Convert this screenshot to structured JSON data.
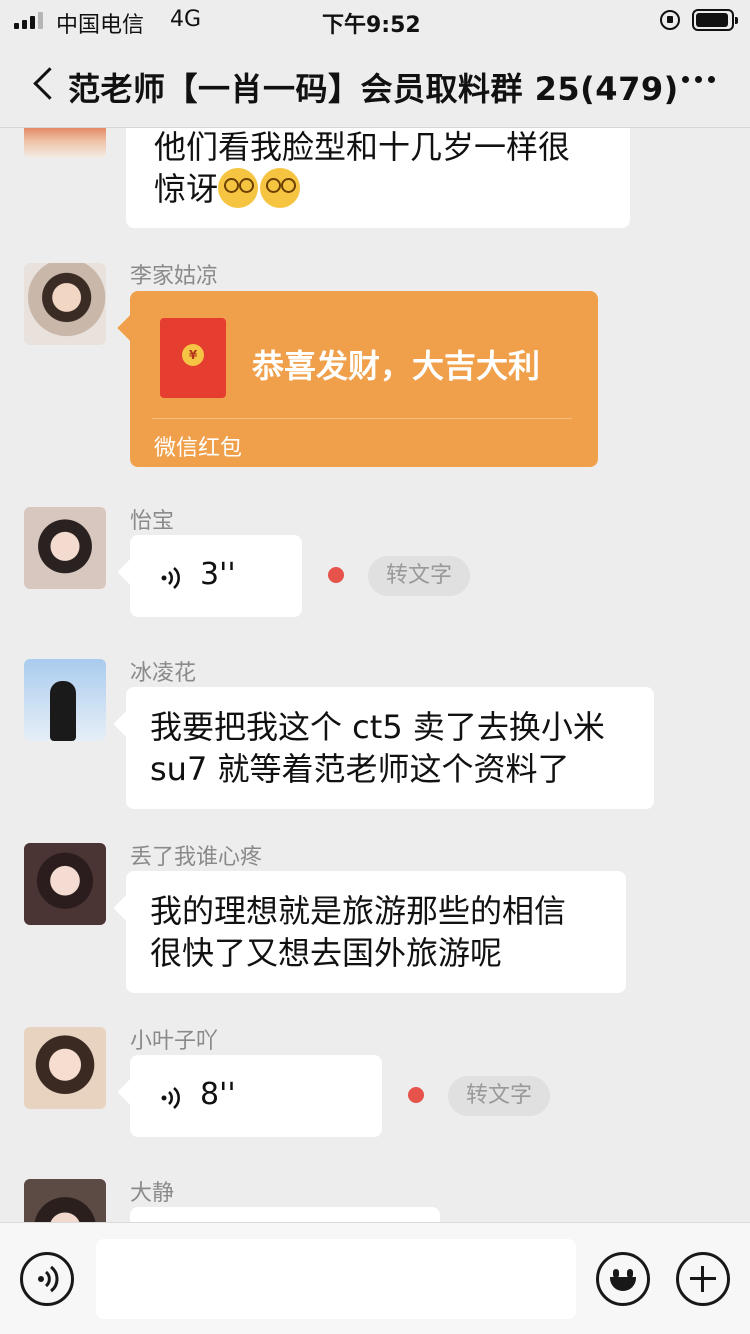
{
  "status": {
    "carrier": "中国电信",
    "network": "4G",
    "time": "下午9:52",
    "battery_level": 0.95
  },
  "header": {
    "title": "范老师【一肖一码】会员取料群 25(479)",
    "back_icon": "chevron-left-icon",
    "more_icon": "ellipsis-icon"
  },
  "messages": [
    {
      "type": "text",
      "sender": "",
      "text": "他们看我脸型和十几岁一样很\n惊讶",
      "emoji_count": 2
    },
    {
      "type": "redpacket",
      "sender": "李家姑凉",
      "title": "恭喜发财，大吉大利",
      "source": "微信红包",
      "coin": "¥"
    },
    {
      "type": "voice",
      "sender": "怡宝",
      "duration": "3''",
      "unread": true,
      "transcribe_label": "转文字"
    },
    {
      "type": "text",
      "sender": "冰凌花",
      "text": "我要把我这个 ct5 卖了去换小米\nsu7 就等着范老师这个资料了"
    },
    {
      "type": "text",
      "sender": "丢了我谁心疼",
      "text": "我的理想就是旅游那些的相信\n很快了又想去国外旅游呢"
    },
    {
      "type": "voice",
      "sender": "小叶子吖",
      "duration": "8''",
      "unread": true,
      "transcribe_label": "转文字"
    },
    {
      "type": "partial",
      "sender": "大静"
    }
  ],
  "input_bar": {
    "voice_icon": "voice-input-icon",
    "emoji_icon": "smiley-icon",
    "plus_icon": "plus-icon",
    "text_value": ""
  },
  "colors": {
    "background": "#ededed",
    "bubble": "#ffffff",
    "redpacket": "#f0a04b",
    "unread_dot": "#e5534b"
  }
}
